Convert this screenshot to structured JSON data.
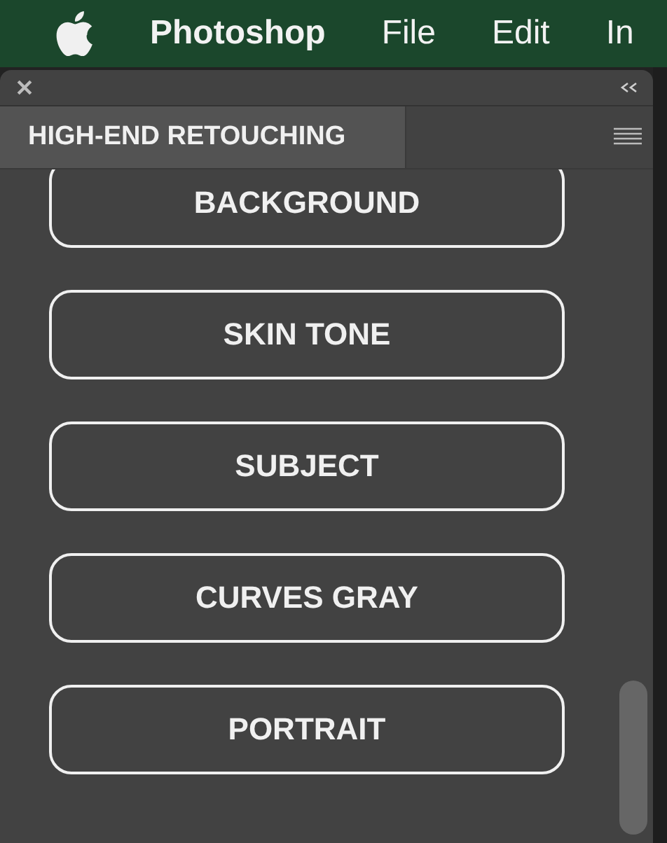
{
  "menu_bar": {
    "app": "Photoshop",
    "items": [
      "File",
      "Edit",
      "In"
    ]
  },
  "panel": {
    "tabs": [
      {
        "label": "HIGH-END RETOUCHING",
        "selected": true
      }
    ],
    "buttons": [
      "BACKGROUND",
      "SKIN TONE",
      "SUBJECT",
      "CURVES GRAY",
      "PORTRAIT"
    ]
  }
}
